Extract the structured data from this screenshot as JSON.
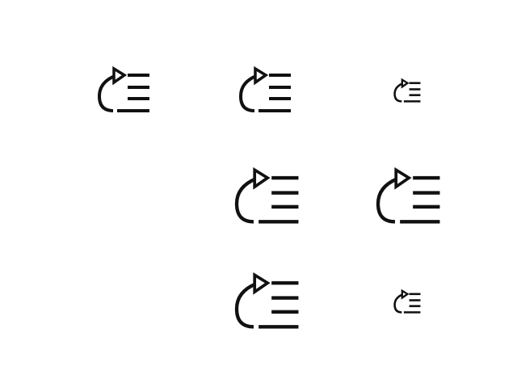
{
  "icon": {
    "name": "redo-list-icon",
    "color": "#111111",
    "background": "#ffffff"
  },
  "grid": {
    "rows": 3,
    "columns": 3,
    "cells": [
      {
        "row": 1,
        "col": 1,
        "present": true,
        "size": "medium"
      },
      {
        "row": 1,
        "col": 2,
        "present": true,
        "size": "medium"
      },
      {
        "row": 1,
        "col": 3,
        "present": true,
        "size": "small"
      },
      {
        "row": 2,
        "col": 1,
        "present": false
      },
      {
        "row": 2,
        "col": 2,
        "present": true,
        "size": "large"
      },
      {
        "row": 2,
        "col": 3,
        "present": true,
        "size": "large"
      },
      {
        "row": 3,
        "col": 1,
        "present": false
      },
      {
        "row": 3,
        "col": 2,
        "present": true,
        "size": "large"
      },
      {
        "row": 3,
        "col": 3,
        "present": true,
        "size": "small"
      }
    ]
  }
}
